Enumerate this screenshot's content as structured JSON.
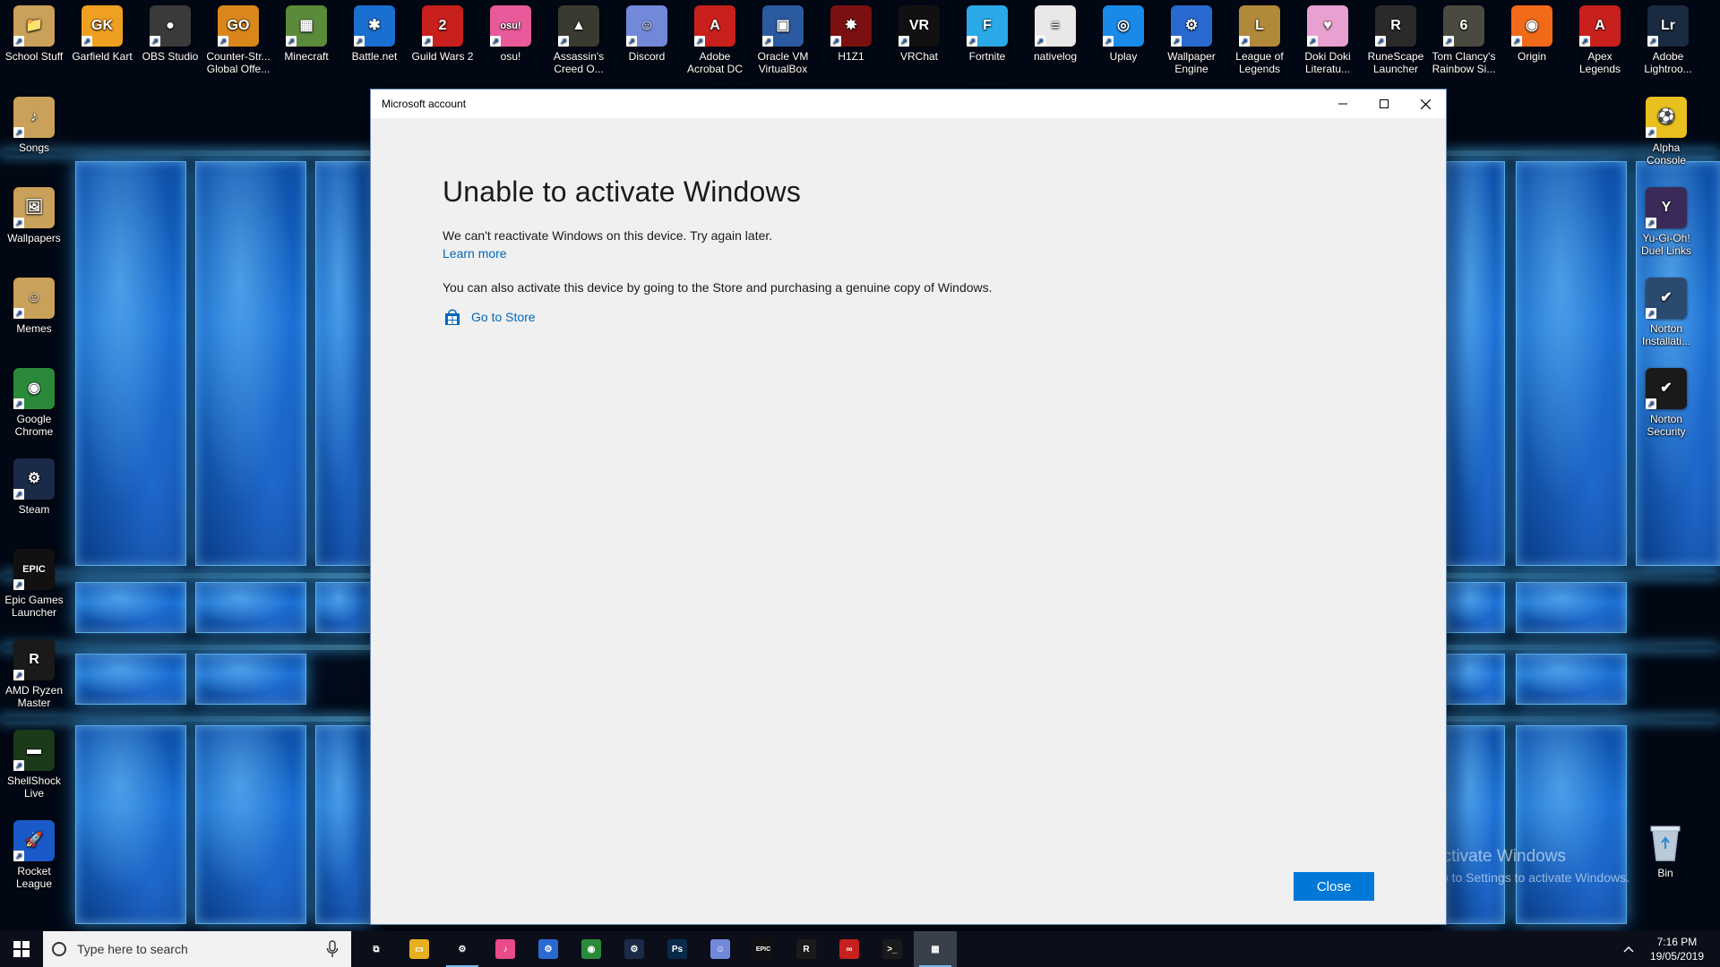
{
  "desktop": {
    "top_icons": [
      {
        "label": "School Stuff",
        "color": "#c9a15a",
        "glyph": "📁"
      },
      {
        "label": "Garfield Kart",
        "color": "#f0a020",
        "glyph": "GK"
      },
      {
        "label": "OBS Studio",
        "color": "#3a3a3a",
        "glyph": "●"
      },
      {
        "label": "Counter-Str... Global Offe...",
        "color": "#d9861c",
        "glyph": "GO"
      },
      {
        "label": "Minecraft",
        "color": "#5a8a3a",
        "glyph": "▦"
      },
      {
        "label": "Battle.net",
        "color": "#1a6fd0",
        "glyph": "✱"
      },
      {
        "label": "Guild Wars 2",
        "color": "#c8201c",
        "glyph": "2"
      },
      {
        "label": "osu!",
        "color": "#e85a9a",
        "glyph": "osu!"
      },
      {
        "label": "Assassin's Creed O...",
        "color": "#3a3a30",
        "glyph": "▲"
      },
      {
        "label": "Discord",
        "color": "#7289da",
        "glyph": "☺"
      },
      {
        "label": "Adobe Acrobat DC",
        "color": "#c8201c",
        "glyph": "A"
      },
      {
        "label": "Oracle VM VirtualBox",
        "color": "#2c5aa0",
        "glyph": "▣"
      },
      {
        "label": "H1Z1",
        "color": "#7a1010",
        "glyph": "✸"
      },
      {
        "label": "VRChat",
        "color": "#111111",
        "glyph": "VR"
      },
      {
        "label": "Fortnite",
        "color": "#2aa8e8",
        "glyph": "F"
      },
      {
        "label": "nativelog",
        "color": "#e8e8e8",
        "glyph": "≡"
      },
      {
        "label": "Uplay",
        "color": "#1a8ae8",
        "glyph": "◎"
      },
      {
        "label": "Wallpaper Engine",
        "color": "#2a6ad0",
        "glyph": "⚙"
      },
      {
        "label": "League of Legends",
        "color": "#b08a3a",
        "glyph": "L"
      },
      {
        "label": "Doki Doki Literatu...",
        "color": "#e8a0d0",
        "glyph": "♥"
      },
      {
        "label": "RuneScape Launcher",
        "color": "#2a2a2a",
        "glyph": "R"
      },
      {
        "label": "Tom Clancy's Rainbow Si...",
        "color": "#4a4a40",
        "glyph": "6"
      },
      {
        "label": "Origin",
        "color": "#f06a1a",
        "glyph": "◉"
      },
      {
        "label": "Apex Legends",
        "color": "#c8201c",
        "glyph": "A"
      },
      {
        "label": "Adobe Lightroo...",
        "color": "#1a2a40",
        "glyph": "Lr"
      }
    ],
    "left_icons": [
      {
        "label": "Songs",
        "color": "#c9a15a",
        "glyph": "♪"
      },
      {
        "label": "Wallpapers",
        "color": "#c9a15a",
        "glyph": "🖼"
      },
      {
        "label": "Memes",
        "color": "#c9a15a",
        "glyph": "☺"
      },
      {
        "label": "Google Chrome",
        "color": "#2a8a3a",
        "glyph": "◉"
      },
      {
        "label": "Steam",
        "color": "#1a2a48",
        "glyph": "⚙"
      },
      {
        "label": "Epic Games Launcher",
        "color": "#111111",
        "glyph": "EPIC"
      },
      {
        "label": "AMD Ryzen Master",
        "color": "#1a1a1a",
        "glyph": "R"
      },
      {
        "label": "ShellShock Live",
        "color": "#1a3a1a",
        "glyph": "▬"
      },
      {
        "label": "Rocket League",
        "color": "#1a5ac8",
        "glyph": "🚀"
      }
    ],
    "right_icons": [
      {
        "label": "Alpha Console",
        "color": "#e8c020",
        "glyph": "⚽"
      },
      {
        "label": "Yu-Gi-Oh! Duel Links",
        "color": "#3a2a5a",
        "glyph": "Y"
      },
      {
        "label": "Norton Installati...",
        "color": "#2a4a70",
        "glyph": "✔"
      },
      {
        "label": "Norton Security",
        "color": "#1a1a1a",
        "glyph": "✔"
      }
    ],
    "bin_label": "Bin"
  },
  "dialog": {
    "window_title": "Microsoft account",
    "heading": "Unable to activate Windows",
    "message": "We can't reactivate Windows on this device. Try again later.",
    "learn_more": "Learn more",
    "store_message": "You can also activate this device by going to the Store and purchasing a genuine copy of Windows.",
    "go_to_store": "Go to Store",
    "close_label": "Close"
  },
  "watermark": {
    "line1": "Activate Windows",
    "line2": "Go to Settings to activate Windows."
  },
  "taskbar": {
    "search_placeholder": "Type here to search",
    "pinned": [
      {
        "name": "task-view",
        "color": "#0c0f1a",
        "glyph": "⧉",
        "open": false
      },
      {
        "name": "file-explorer",
        "color": "#e8b020",
        "glyph": "▭",
        "open": false
      },
      {
        "name": "settings",
        "color": "#0c0f1a",
        "glyph": "⚙",
        "open": true
      },
      {
        "name": "itunes",
        "color": "#e84a8a",
        "glyph": "♪",
        "open": false
      },
      {
        "name": "wallpaper-engine",
        "color": "#2a6ad0",
        "glyph": "⚙",
        "open": false
      },
      {
        "name": "chrome",
        "color": "#2a8a3a",
        "glyph": "◉",
        "open": false
      },
      {
        "name": "steam",
        "color": "#1a2a48",
        "glyph": "⚙",
        "open": false
      },
      {
        "name": "photoshop",
        "color": "#0a2a4a",
        "glyph": "Ps",
        "open": false
      },
      {
        "name": "discord",
        "color": "#7289da",
        "glyph": "☺",
        "open": false
      },
      {
        "name": "epic-games",
        "color": "#111111",
        "glyph": "EPIC",
        "open": false
      },
      {
        "name": "ryzen-master",
        "color": "#1a1a1a",
        "glyph": "R",
        "open": false
      },
      {
        "name": "creative-cloud",
        "color": "#c8201c",
        "glyph": "∞",
        "open": false
      },
      {
        "name": "terminal",
        "color": "#1a1a1a",
        "glyph": ">_",
        "open": false
      },
      {
        "name": "microsoft-store",
        "color": "#3a3f4c",
        "glyph": "▦",
        "open": true
      }
    ],
    "time": "7:16 PM",
    "date": "19/05/2019"
  }
}
